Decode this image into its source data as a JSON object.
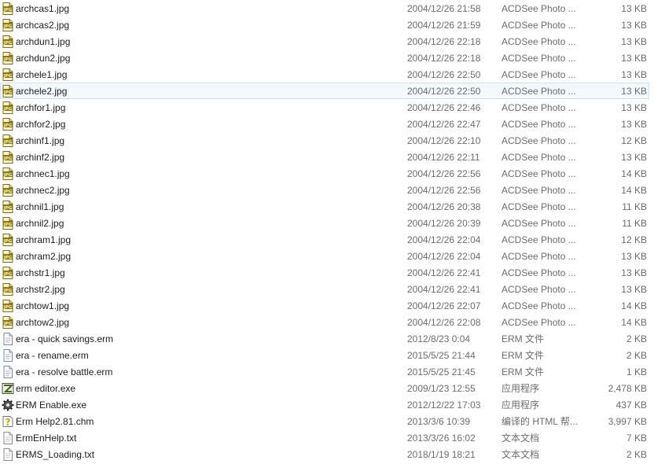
{
  "files": [
    {
      "name": "archcas1.jpg",
      "date": "2004/12/26 21:58",
      "type": "ACDSee Photo ...",
      "size": "13 KB",
      "icon": "jpg-file-icon"
    },
    {
      "name": "archcas2.jpg",
      "date": "2004/12/26 21:59",
      "type": "ACDSee Photo ...",
      "size": "13 KB",
      "icon": "jpg-file-icon"
    },
    {
      "name": "archdun1.jpg",
      "date": "2004/12/26 22:18",
      "type": "ACDSee Photo ...",
      "size": "13 KB",
      "icon": "jpg-file-icon"
    },
    {
      "name": "archdun2.jpg",
      "date": "2004/12/26 22:18",
      "type": "ACDSee Photo ...",
      "size": "13 KB",
      "icon": "jpg-file-icon"
    },
    {
      "name": "archele1.jpg",
      "date": "2004/12/26 22:50",
      "type": "ACDSee Photo ...",
      "size": "13 KB",
      "icon": "jpg-file-icon"
    },
    {
      "name": "archele2.jpg",
      "date": "2004/12/26 22:50",
      "type": "ACDSee Photo ...",
      "size": "13 KB",
      "icon": "jpg-file-icon",
      "selected": true
    },
    {
      "name": "archfor1.jpg",
      "date": "2004/12/26 22:46",
      "type": "ACDSee Photo ...",
      "size": "13 KB",
      "icon": "jpg-file-icon"
    },
    {
      "name": "archfor2.jpg",
      "date": "2004/12/26 22:47",
      "type": "ACDSee Photo ...",
      "size": "13 KB",
      "icon": "jpg-file-icon"
    },
    {
      "name": "archinf1.jpg",
      "date": "2004/12/26 22:10",
      "type": "ACDSee Photo ...",
      "size": "12 KB",
      "icon": "jpg-file-icon"
    },
    {
      "name": "archinf2.jpg",
      "date": "2004/12/26 22:11",
      "type": "ACDSee Photo ...",
      "size": "13 KB",
      "icon": "jpg-file-icon"
    },
    {
      "name": "archnec1.jpg",
      "date": "2004/12/26 22:56",
      "type": "ACDSee Photo ...",
      "size": "14 KB",
      "icon": "jpg-file-icon"
    },
    {
      "name": "archnec2.jpg",
      "date": "2004/12/26 22:56",
      "type": "ACDSee Photo ...",
      "size": "14 KB",
      "icon": "jpg-file-icon"
    },
    {
      "name": "archnil1.jpg",
      "date": "2004/12/26 20:38",
      "type": "ACDSee Photo ...",
      "size": "11 KB",
      "icon": "jpg-file-icon"
    },
    {
      "name": "archnil2.jpg",
      "date": "2004/12/26 20:39",
      "type": "ACDSee Photo ...",
      "size": "11 KB",
      "icon": "jpg-file-icon"
    },
    {
      "name": "archram1.jpg",
      "date": "2004/12/26 22:04",
      "type": "ACDSee Photo ...",
      "size": "12 KB",
      "icon": "jpg-file-icon"
    },
    {
      "name": "archram2.jpg",
      "date": "2004/12/26 22:04",
      "type": "ACDSee Photo ...",
      "size": "13 KB",
      "icon": "jpg-file-icon"
    },
    {
      "name": "archstr1.jpg",
      "date": "2004/12/26 22:41",
      "type": "ACDSee Photo ...",
      "size": "13 KB",
      "icon": "jpg-file-icon"
    },
    {
      "name": "archstr2.jpg",
      "date": "2004/12/26 22:41",
      "type": "ACDSee Photo ...",
      "size": "13 KB",
      "icon": "jpg-file-icon"
    },
    {
      "name": "archtow1.jpg",
      "date": "2004/12/26 22:07",
      "type": "ACDSee Photo ...",
      "size": "14 KB",
      "icon": "jpg-file-icon"
    },
    {
      "name": "archtow2.jpg",
      "date": "2004/12/26 22:08",
      "type": "ACDSee Photo ...",
      "size": "14 KB",
      "icon": "jpg-file-icon"
    },
    {
      "name": "era - quick savings.erm",
      "date": "2012/8/23 0:04",
      "type": "ERM 文件",
      "size": "2 KB",
      "icon": "erm-file-icon"
    },
    {
      "name": "era - rename.erm",
      "date": "2015/5/25 21:44",
      "type": "ERM 文件",
      "size": "2 KB",
      "icon": "erm-file-icon"
    },
    {
      "name": "era - resolve battle.erm",
      "date": "2015/5/25 21:45",
      "type": "ERM 文件",
      "size": "1 KB",
      "icon": "erm-file-icon"
    },
    {
      "name": "erm editor.exe",
      "date": "2009/1/23 12:55",
      "type": "应用程序",
      "size": "2,478 KB",
      "icon": "editor-exe-icon"
    },
    {
      "name": "ERM Enable.exe",
      "date": "2012/12/22 17:03",
      "type": "应用程序",
      "size": "437 KB",
      "icon": "gear-exe-icon"
    },
    {
      "name": "Erm Help2.81.chm",
      "date": "2013/3/6 10:39",
      "type": "编译的 HTML 帮...",
      "size": "3,997 KB",
      "icon": "chm-help-icon"
    },
    {
      "name": "ErmEnHelp.txt",
      "date": "2013/3/26 16:02",
      "type": "文本文档",
      "size": "7 KB",
      "icon": "txt-file-icon"
    },
    {
      "name": "ERMS_Loading.txt",
      "date": "2018/1/19 18:21",
      "type": "文本文档",
      "size": "2 KB",
      "icon": "txt-file-icon"
    }
  ]
}
